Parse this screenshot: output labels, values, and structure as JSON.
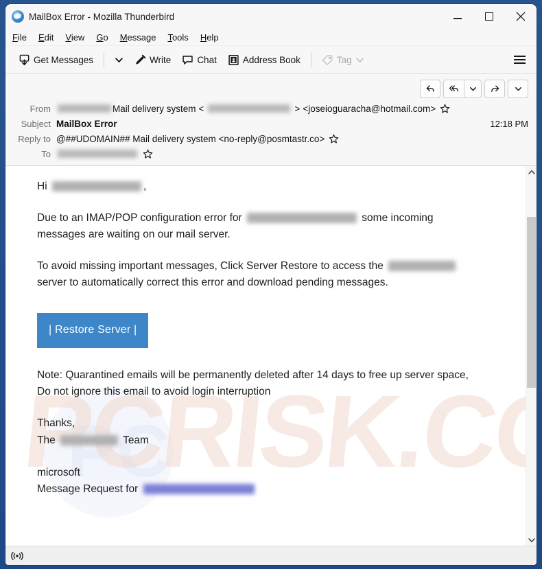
{
  "window": {
    "title": "MailBox Error - Mozilla Thunderbird",
    "app_icon": "thunderbird-icon",
    "controls": {
      "minimize": "minimize-icon",
      "maximize": "maximize-icon",
      "close": "close-icon"
    }
  },
  "menubar": {
    "items": [
      {
        "accel": "F",
        "rest": "ile"
      },
      {
        "accel": "E",
        "rest": "dit"
      },
      {
        "accel": "V",
        "rest": "iew"
      },
      {
        "accel": "G",
        "rest": "o"
      },
      {
        "accel": "M",
        "rest": "essage"
      },
      {
        "accel": "T",
        "rest": "ools"
      },
      {
        "accel": "H",
        "rest": "elp"
      }
    ]
  },
  "toolbar": {
    "get_messages": "Get Messages",
    "write": "Write",
    "chat": "Chat",
    "address_book": "Address Book",
    "tag": "Tag",
    "menu_icon": "hamburger-menu-icon"
  },
  "reply_bar": {
    "reply": "reply-icon",
    "reply_all": "reply-all-icon",
    "reply_all_dropdown": "chevron-down-icon",
    "forward": "forward-icon",
    "more_dropdown": "chevron-down-icon"
  },
  "headers": {
    "from_label": "From",
    "from_redacted_1": "[redacted-domain]",
    "from_name": "Mail delivery system",
    "from_open_bracket": "<",
    "from_redacted_2": "[redacted-address]",
    "from_close_bracket": ">",
    "from_address": "<joseioguaracha@hotmail.com>",
    "subject_label": "Subject",
    "subject_value": "MailBox Error",
    "time": "12:18 PM",
    "reply_to_label": "Reply to",
    "reply_to_value": "@##UDOMAIN## Mail delivery system <no-reply@posmtastr.co>",
    "to_label": "To",
    "to_redacted": "[redacted-recipient]",
    "star_icon": "star-icon"
  },
  "message": {
    "greeting_prefix": "Hi",
    "greeting_redacted": "[redacted-email]",
    "greeting_suffix": ",",
    "para1_before": "Due to an IMAP/POP configuration error for",
    "para1_redacted": "[redacted-email]",
    "para1_after": "some incoming messages are waiting on our mail server.",
    "para2_before": "To avoid missing important messages, Click Server Restore to access the",
    "para2_redacted": "[redacted-domain]",
    "para2_after": "server to automatically correct this error and download pending messages.",
    "button_label": "| Restore Server |",
    "note": "Note: Quarantined emails will be permanently deleted after 14 days to free up server space, Do not ignore this email to avoid login interruption",
    "sign_thanks": "Thanks,",
    "sign_the": "The",
    "sign_redacted": "[redacted-domain]",
    "sign_team": "Team",
    "footer_microsoft": "microsoft",
    "footer_request_before": "Message Request for",
    "footer_request_redacted": "[redacted-email]"
  },
  "statusbar": {
    "icon": "broadcast-icon",
    "text": ""
  },
  "watermark": {
    "text": "PCRISK.COM"
  },
  "colors": {
    "desktop": "#1f4887",
    "chrome": "#f7f7f7",
    "button_blue": "#3d87c9",
    "text": "#1d1d1d",
    "label_grey": "#6d6d6d"
  }
}
